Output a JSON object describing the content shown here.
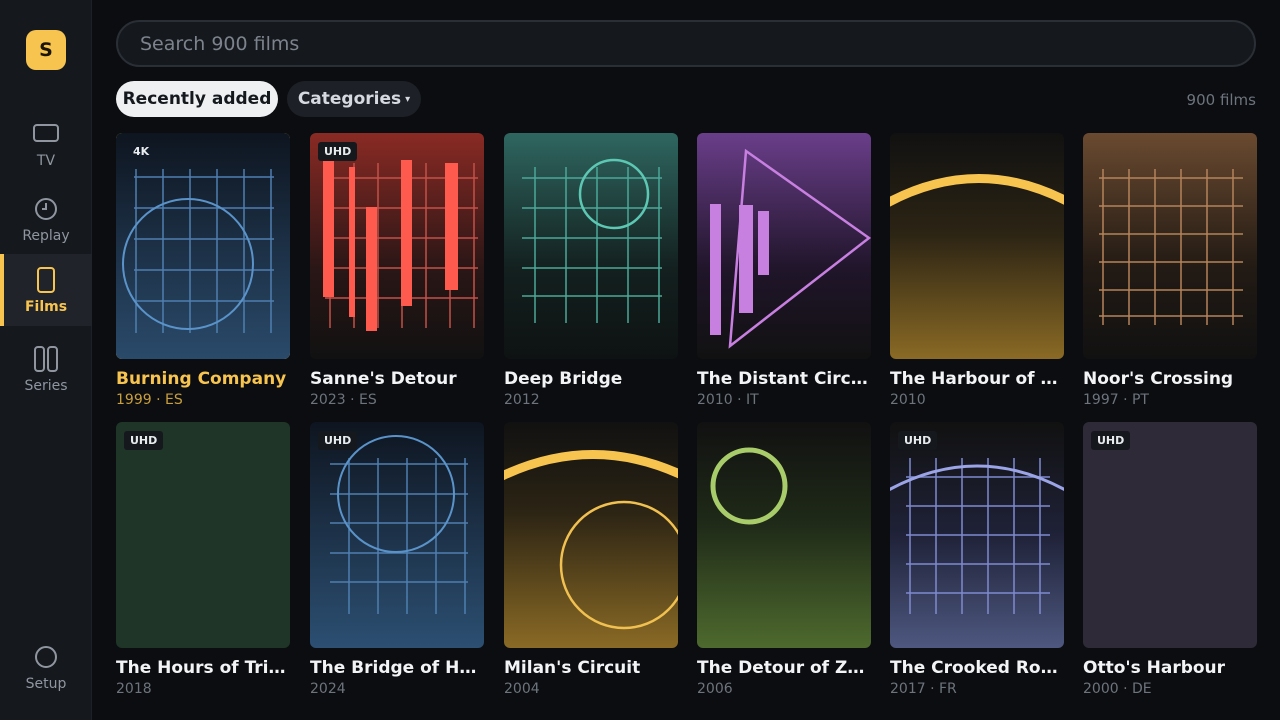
{
  "app": {
    "logo_letter": "S",
    "accent": "#f7c44f"
  },
  "sidebar": {
    "items": [
      {
        "label": "TV",
        "icon": "tv-icon"
      },
      {
        "label": "Replay",
        "icon": "clock-icon"
      },
      {
        "label": "Films",
        "icon": "film-icon",
        "active": true
      },
      {
        "label": "Series",
        "icon": "series-icon"
      }
    ],
    "setup": {
      "label": "Setup",
      "icon": "settings-circle-icon"
    }
  },
  "search": {
    "placeholder": "Search 900 films"
  },
  "filters": {
    "recent": "Recently added",
    "categories": "Categories",
    "caret": "▾"
  },
  "result_count": "900 films",
  "films": [
    {
      "title": "Burning Company",
      "meta": "1999 · ES",
      "badge": "4K"
    },
    {
      "title": "Sanne's Detour",
      "meta": "2023 · ES",
      "badge": "UHD"
    },
    {
      "title": "Deep Bridge",
      "meta": "2012",
      "badge": ""
    },
    {
      "title": "The Distant Circuit",
      "meta": "2010 · IT",
      "badge": ""
    },
    {
      "title": "The Harbour of Lu...",
      "meta": "2010",
      "badge": ""
    },
    {
      "title": "Noor's Crossing",
      "meta": "1997 · PT",
      "badge": ""
    },
    {
      "title": "The Hours of Trieste",
      "meta": "2018",
      "badge": "UHD"
    },
    {
      "title": "The Bridge of Hartl...",
      "meta": "2024",
      "badge": "UHD"
    },
    {
      "title": "Milan's Circuit",
      "meta": "2004",
      "badge": ""
    },
    {
      "title": "The Detour of Zeel...",
      "meta": "2006",
      "badge": ""
    },
    {
      "title": "The Crooked Rooms",
      "meta": "2017 · FR",
      "badge": "UHD"
    },
    {
      "title": "Otto's Harbour",
      "meta": "2000 · DE",
      "badge": "UHD"
    }
  ]
}
